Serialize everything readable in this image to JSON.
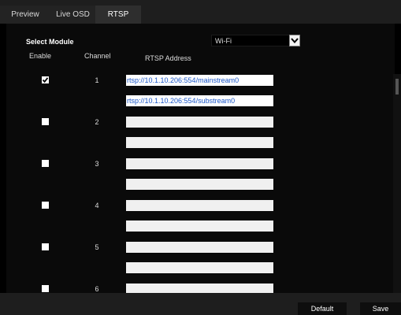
{
  "tabs": [
    {
      "label": "Preview",
      "active": false
    },
    {
      "label": "Live OSD",
      "active": false
    },
    {
      "label": "RTSP",
      "active": true
    }
  ],
  "select_module": {
    "label": "Select Module",
    "value": "Wi-Fi"
  },
  "headers": {
    "enable": "Enable",
    "channel": "Channel",
    "address": "RTSP Address"
  },
  "channels": [
    {
      "number": "1",
      "enabled": true,
      "main": "rtsp://10.1.10.206:554/mainstream0",
      "sub": "rtsp://10.1.10.206:554/substream0"
    },
    {
      "number": "2",
      "enabled": false,
      "main": "",
      "sub": ""
    },
    {
      "number": "3",
      "enabled": false,
      "main": "",
      "sub": ""
    },
    {
      "number": "4",
      "enabled": false,
      "main": "",
      "sub": ""
    },
    {
      "number": "5",
      "enabled": false,
      "main": "",
      "sub": ""
    },
    {
      "number": "6",
      "enabled": false,
      "main": "",
      "sub": ""
    }
  ],
  "buttons": {
    "default": "Default",
    "save": "Save"
  },
  "colors": {
    "link_text": "#1a56c8",
    "background": "#000000",
    "bar": "#1e1e1e"
  }
}
